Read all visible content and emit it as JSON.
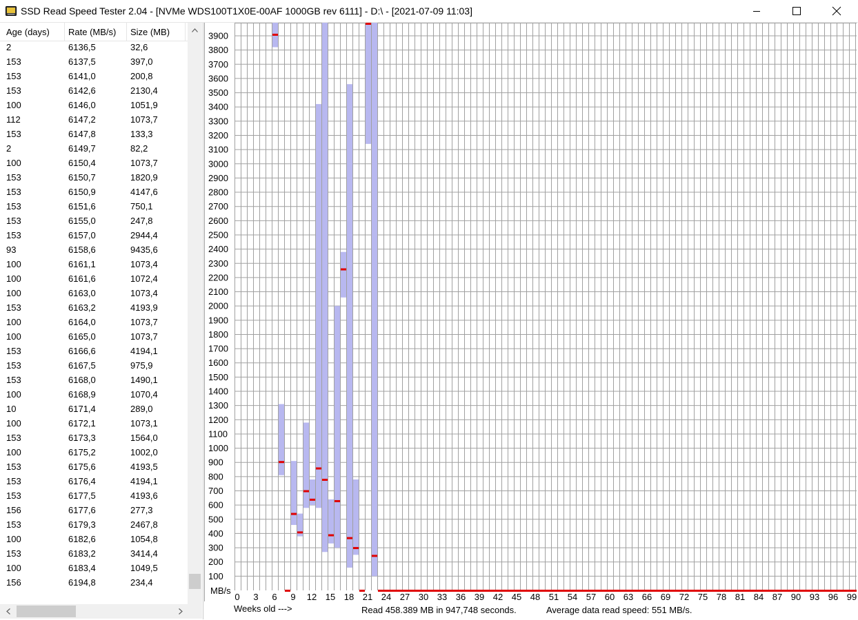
{
  "window": {
    "title": "SSD Read Speed Tester 2.04 - [NVMe WDS100T1X0E-00AF 1000GB rev 6111] - D:\\ - [2021-07-09 11:03]",
    "app_icon": "hdd-icon",
    "controls": [
      "minimize-icon",
      "maximize-icon",
      "close-icon"
    ]
  },
  "list": {
    "columns": [
      "Age (days)",
      "Rate (MB/s)",
      "Size (MB)"
    ],
    "rows": [
      [
        "2",
        "6136,5",
        "32,6"
      ],
      [
        "153",
        "6137,5",
        "397,0"
      ],
      [
        "153",
        "6141,0",
        "200,8"
      ],
      [
        "153",
        "6142,6",
        "2130,4"
      ],
      [
        "100",
        "6146,0",
        "1051,9"
      ],
      [
        "112",
        "6147,2",
        "1073,7"
      ],
      [
        "153",
        "6147,8",
        "133,3"
      ],
      [
        "2",
        "6149,7",
        "82,2"
      ],
      [
        "100",
        "6150,4",
        "1073,7"
      ],
      [
        "153",
        "6150,7",
        "1820,9"
      ],
      [
        "153",
        "6150,9",
        "4147,6"
      ],
      [
        "153",
        "6151,6",
        "750,1"
      ],
      [
        "153",
        "6155,0",
        "247,8"
      ],
      [
        "153",
        "6157,0",
        "2944,4"
      ],
      [
        "93",
        "6158,6",
        "9435,6"
      ],
      [
        "100",
        "6161,1",
        "1073,4"
      ],
      [
        "100",
        "6161,6",
        "1072,4"
      ],
      [
        "100",
        "6163,0",
        "1073,4"
      ],
      [
        "153",
        "6163,2",
        "4193,9"
      ],
      [
        "100",
        "6164,0",
        "1073,7"
      ],
      [
        "100",
        "6165,0",
        "1073,7"
      ],
      [
        "153",
        "6166,6",
        "4194,1"
      ],
      [
        "153",
        "6167,5",
        "975,9"
      ],
      [
        "153",
        "6168,0",
        "1490,1"
      ],
      [
        "100",
        "6168,9",
        "1070,4"
      ],
      [
        "10",
        "6171,4",
        "289,0"
      ],
      [
        "100",
        "6172,1",
        "1073,1"
      ],
      [
        "153",
        "6173,3",
        "1564,0"
      ],
      [
        "100",
        "6175,2",
        "1002,0"
      ],
      [
        "153",
        "6175,6",
        "4193,5"
      ],
      [
        "153",
        "6176,4",
        "4194,1"
      ],
      [
        "153",
        "6177,5",
        "4193,6"
      ],
      [
        "156",
        "6177,6",
        "277,3"
      ],
      [
        "153",
        "6179,3",
        "2467,8"
      ],
      [
        "100",
        "6182,6",
        "1054,8"
      ],
      [
        "153",
        "6183,2",
        "3414,4"
      ],
      [
        "100",
        "6183,4",
        "1049,5"
      ],
      [
        "156",
        "6194,8",
        "234,4"
      ]
    ],
    "scroll_icons": [
      "scroll-up-icon",
      "scroll-left-icon",
      "scroll-right-icon"
    ]
  },
  "chart_data": {
    "type": "bar",
    "ylabel": "MB/s",
    "xlabel": "Weeks old --->",
    "ylim": [
      0,
      4000
    ],
    "y_ticks": [
      3900,
      3800,
      3700,
      3600,
      3500,
      3400,
      3300,
      3200,
      3100,
      3000,
      2900,
      2800,
      2700,
      2600,
      2500,
      2400,
      2300,
      2200,
      2100,
      2000,
      1900,
      1800,
      1700,
      1600,
      1500,
      1400,
      1300,
      1200,
      1100,
      1000,
      900,
      800,
      700,
      600,
      500,
      400,
      300,
      200,
      100
    ],
    "x_tick_labels": [
      "0",
      "3",
      "6",
      "9",
      "12",
      "15",
      "18",
      "21",
      "24",
      "27",
      "30",
      "33",
      "36",
      "39",
      "42",
      "45",
      "48",
      "51",
      "54",
      "57",
      "60",
      "63",
      "66",
      "69",
      "72",
      "75",
      "78",
      "81",
      "84",
      "87",
      "90",
      "93",
      "96",
      "99"
    ],
    "x_step": 3,
    "grid": true,
    "bar_color": "#b8b8f0",
    "avg_color": "#e00000",
    "grid_color": "#a0a0a0",
    "series": [
      {
        "week": 6,
        "min": 3820,
        "max": 4000,
        "avg": 3910
      },
      {
        "week": 7,
        "min": 810,
        "max": 1310,
        "avg": 905
      },
      {
        "week": 8,
        "min": 0,
        "max": 0,
        "avg": 0
      },
      {
        "week": 9,
        "min": 460,
        "max": 910,
        "avg": 540
      },
      {
        "week": 10,
        "min": 380,
        "max": 540,
        "avg": 410
      },
      {
        "week": 11,
        "min": 580,
        "max": 1180,
        "avg": 700
      },
      {
        "week": 12,
        "min": 600,
        "max": 780,
        "avg": 640
      },
      {
        "week": 13,
        "min": 580,
        "max": 3420,
        "avg": 860
      },
      {
        "week": 14,
        "min": 270,
        "max": 4000,
        "avg": 780
      },
      {
        "week": 15,
        "min": 330,
        "max": 640,
        "avg": 390
      },
      {
        "week": 16,
        "min": 300,
        "max": 2000,
        "avg": 630
      },
      {
        "week": 17,
        "min": 2060,
        "max": 2380,
        "avg": 2260
      },
      {
        "week": 18,
        "min": 160,
        "max": 3560,
        "avg": 370
      },
      {
        "week": 19,
        "min": 250,
        "max": 780,
        "avg": 300
      },
      {
        "week": 20,
        "min": 0,
        "max": 0,
        "avg": 0
      },
      {
        "week": 21,
        "min": 3140,
        "max": 4000,
        "avg": 4000
      },
      {
        "week": 22,
        "min": 100,
        "max": 4000,
        "avg": 245
      }
    ],
    "zero_line_from_week": 23
  },
  "footer": {
    "weeks_label": "Weeks old --->",
    "summary": "Read 458.389 MB in 947,748 seconds.",
    "average": "Average data read speed: 551 MB/s."
  }
}
